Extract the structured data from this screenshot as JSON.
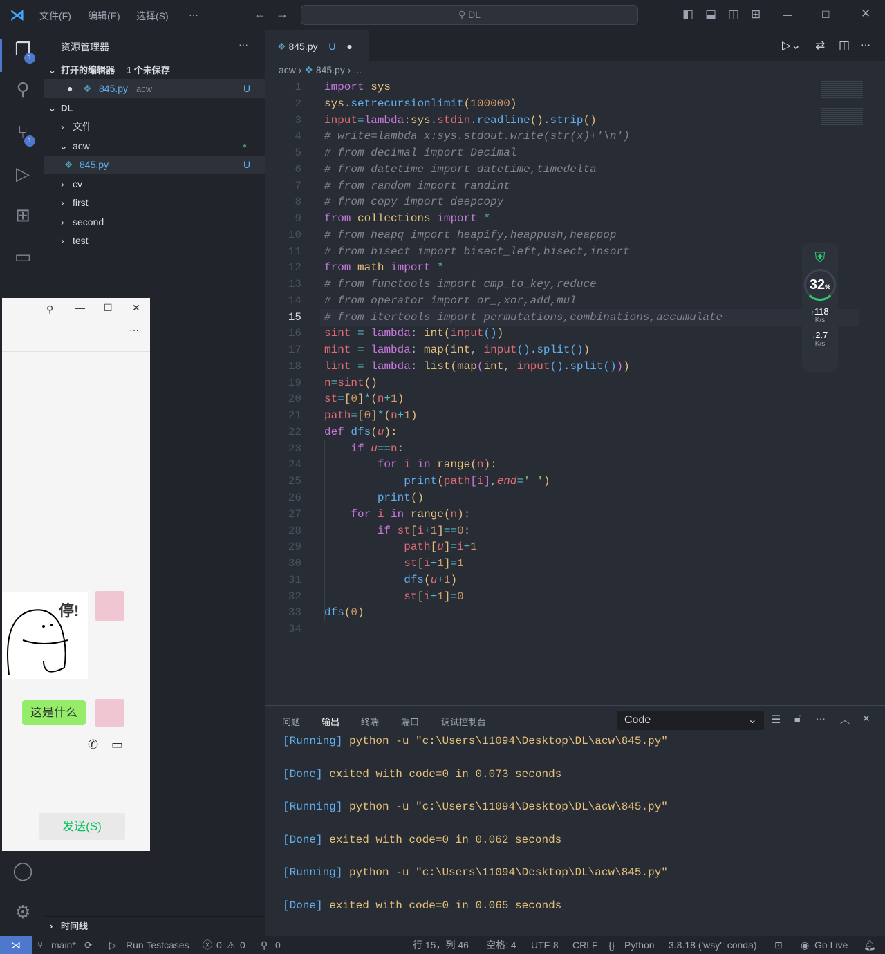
{
  "titlebar": {
    "menus": [
      "文件(F)",
      "编辑(E)",
      "选择(S)",
      "···"
    ],
    "search": "DL"
  },
  "activity": {
    "explorer_badge": "1",
    "scm_badge": "1"
  },
  "sidebar": {
    "title": "资源管理器",
    "more": "···",
    "open_editors": "打开的编辑器",
    "unsaved": "1 个未保存",
    "open_file": "845.py",
    "open_file_dir": "acw",
    "open_file_status": "U",
    "root": "DL",
    "tree": [
      {
        "label": "文件",
        "type": "folder",
        "open": false
      },
      {
        "label": "acw",
        "type": "folder",
        "open": true
      },
      {
        "label": "845.py",
        "type": "file",
        "status": "U"
      },
      {
        "label": "cv",
        "type": "folder"
      },
      {
        "label": "first",
        "type": "folder"
      },
      {
        "label": "second",
        "type": "folder"
      },
      {
        "label": "test",
        "type": "folder"
      }
    ],
    "timeline": "时间线"
  },
  "editor": {
    "tab": "845.py",
    "tab_status": "U",
    "breadcrumb": [
      "acw",
      "845.py",
      "..."
    ],
    "current_line": 15,
    "lines": [
      [
        [
          "k",
          "import"
        ],
        [
          "p",
          " "
        ],
        [
          "v",
          "sys"
        ]
      ],
      [
        [
          "v",
          "sys"
        ],
        [
          "p",
          "."
        ],
        [
          "f",
          "setrecursionlimit"
        ],
        [
          "v",
          "("
        ],
        [
          "n",
          "100000"
        ],
        [
          "v",
          ")"
        ]
      ],
      [
        [
          "r",
          "input"
        ],
        [
          "o",
          "="
        ],
        [
          "k",
          "lambda"
        ],
        [
          "p",
          ":"
        ],
        [
          "v",
          "sys"
        ],
        [
          "p",
          "."
        ],
        [
          "r",
          "stdin"
        ],
        [
          "p",
          "."
        ],
        [
          "f",
          "readline"
        ],
        [
          "v",
          "()"
        ],
        [
          "p",
          "."
        ],
        [
          "f",
          "strip"
        ],
        [
          "v",
          "()"
        ]
      ],
      [
        [
          "c",
          "# write=lambda x:sys.stdout.write(str(x)+'\\n')"
        ]
      ],
      [
        [
          "c",
          "# from decimal import Decimal"
        ]
      ],
      [
        [
          "c",
          "# from datetime import datetime,timedelta"
        ]
      ],
      [
        [
          "c",
          "# from random import randint"
        ]
      ],
      [
        [
          "c",
          "# from copy import deepcopy"
        ]
      ],
      [
        [
          "k",
          "from"
        ],
        [
          "p",
          " "
        ],
        [
          "v",
          "collections"
        ],
        [
          "p",
          " "
        ],
        [
          "k",
          "import"
        ],
        [
          "p",
          " "
        ],
        [
          "o",
          "*"
        ]
      ],
      [
        [
          "c",
          "# from heapq import heapify,heappush,heappop"
        ]
      ],
      [
        [
          "c",
          "# from bisect import bisect_left,bisect,insort"
        ]
      ],
      [
        [
          "k",
          "from"
        ],
        [
          "p",
          " "
        ],
        [
          "v",
          "math"
        ],
        [
          "p",
          " "
        ],
        [
          "k",
          "import"
        ],
        [
          "p",
          " "
        ],
        [
          "o",
          "*"
        ]
      ],
      [
        [
          "c",
          "# from functools import cmp_to_key,reduce"
        ]
      ],
      [
        [
          "c",
          "# from operator import or_,xor,add,mul"
        ]
      ],
      [
        [
          "c",
          "# from itertools import permutations,combinations,accumulate"
        ]
      ],
      [
        [
          "r",
          "sint"
        ],
        [
          "p",
          " "
        ],
        [
          "o",
          "="
        ],
        [
          "p",
          " "
        ],
        [
          "k",
          "lambda"
        ],
        [
          "p",
          ": "
        ],
        [
          "v",
          "int"
        ],
        [
          "v",
          "("
        ],
        [
          "r",
          "input"
        ],
        [
          "f",
          "()"
        ],
        [
          "v",
          ")"
        ]
      ],
      [
        [
          "r",
          "mint"
        ],
        [
          "p",
          " "
        ],
        [
          "o",
          "="
        ],
        [
          "p",
          " "
        ],
        [
          "k",
          "lambda"
        ],
        [
          "p",
          ": "
        ],
        [
          "v",
          "map"
        ],
        [
          "v",
          "("
        ],
        [
          "v",
          "int"
        ],
        [
          "p",
          ", "
        ],
        [
          "r",
          "input"
        ],
        [
          "f",
          "()"
        ],
        [
          "p",
          "."
        ],
        [
          "f",
          "split"
        ],
        [
          "f",
          "()"
        ],
        [
          "v",
          ")"
        ]
      ],
      [
        [
          "r",
          "lint"
        ],
        [
          "p",
          " "
        ],
        [
          "o",
          "="
        ],
        [
          "p",
          " "
        ],
        [
          "k",
          "lambda"
        ],
        [
          "p",
          ": "
        ],
        [
          "v",
          "list"
        ],
        [
          "v",
          "("
        ],
        [
          "v",
          "map"
        ],
        [
          "k",
          "("
        ],
        [
          "v",
          "int"
        ],
        [
          "p",
          ", "
        ],
        [
          "r",
          "input"
        ],
        [
          "f",
          "()"
        ],
        [
          "p",
          "."
        ],
        [
          "f",
          "split"
        ],
        [
          "f",
          "()"
        ],
        [
          "k",
          ")"
        ],
        [
          "v",
          ")"
        ]
      ],
      [
        [
          "r",
          "n"
        ],
        [
          "o",
          "="
        ],
        [
          "r",
          "sint"
        ],
        [
          "v",
          "()"
        ]
      ],
      [
        [
          "r",
          "st"
        ],
        [
          "o",
          "="
        ],
        [
          "v",
          "["
        ],
        [
          "n",
          "0"
        ],
        [
          "v",
          "]"
        ],
        [
          "o",
          "*"
        ],
        [
          "v",
          "("
        ],
        [
          "r",
          "n"
        ],
        [
          "o",
          "+"
        ],
        [
          "n",
          "1"
        ],
        [
          "v",
          ")"
        ]
      ],
      [
        [
          "r",
          "path"
        ],
        [
          "o",
          "="
        ],
        [
          "v",
          "["
        ],
        [
          "n",
          "0"
        ],
        [
          "v",
          "]"
        ],
        [
          "o",
          "*"
        ],
        [
          "v",
          "("
        ],
        [
          "r",
          "n"
        ],
        [
          "o",
          "+"
        ],
        [
          "n",
          "1"
        ],
        [
          "v",
          ")"
        ]
      ],
      [
        [
          "k",
          "def"
        ],
        [
          "p",
          " "
        ],
        [
          "f",
          "dfs"
        ],
        [
          "v",
          "("
        ],
        [
          "i",
          "u"
        ],
        [
          "v",
          "):"
        ]
      ],
      [
        [
          "p",
          "    "
        ],
        [
          "k",
          "if"
        ],
        [
          "p",
          " "
        ],
        [
          "i",
          "u"
        ],
        [
          "o",
          "=="
        ],
        [
          "r",
          "n"
        ],
        [
          "p",
          ":"
        ]
      ],
      [
        [
          "p",
          "        "
        ],
        [
          "k",
          "for"
        ],
        [
          "p",
          " "
        ],
        [
          "r",
          "i"
        ],
        [
          "p",
          " "
        ],
        [
          "k",
          "in"
        ],
        [
          "p",
          " "
        ],
        [
          "v",
          "range"
        ],
        [
          "v",
          "("
        ],
        [
          "r",
          "n"
        ],
        [
          "v",
          "):"
        ]
      ],
      [
        [
          "p",
          "            "
        ],
        [
          "f",
          "print"
        ],
        [
          "v",
          "("
        ],
        [
          "r",
          "path"
        ],
        [
          "k",
          "["
        ],
        [
          "r",
          "i"
        ],
        [
          "k",
          "]"
        ],
        [
          "p",
          ","
        ],
        [
          "i",
          "end"
        ],
        [
          "o",
          "="
        ],
        [
          "g",
          "' '"
        ],
        [
          "v",
          ")"
        ]
      ],
      [
        [
          "p",
          "        "
        ],
        [
          "f",
          "print"
        ],
        [
          "v",
          "()"
        ]
      ],
      [
        [
          "p",
          "    "
        ],
        [
          "k",
          "for"
        ],
        [
          "p",
          " "
        ],
        [
          "r",
          "i"
        ],
        [
          "p",
          " "
        ],
        [
          "k",
          "in"
        ],
        [
          "p",
          " "
        ],
        [
          "v",
          "range"
        ],
        [
          "v",
          "("
        ],
        [
          "r",
          "n"
        ],
        [
          "v",
          "):"
        ]
      ],
      [
        [
          "p",
          "        "
        ],
        [
          "k",
          "if"
        ],
        [
          "p",
          " "
        ],
        [
          "r",
          "st"
        ],
        [
          "v",
          "["
        ],
        [
          "r",
          "i"
        ],
        [
          "o",
          "+"
        ],
        [
          "n",
          "1"
        ],
        [
          "v",
          "]"
        ],
        [
          "o",
          "=="
        ],
        [
          "n",
          "0"
        ],
        [
          "p",
          ":"
        ]
      ],
      [
        [
          "p",
          "            "
        ],
        [
          "r",
          "path"
        ],
        [
          "v",
          "["
        ],
        [
          "i",
          "u"
        ],
        [
          "v",
          "]"
        ],
        [
          "o",
          "="
        ],
        [
          "r",
          "i"
        ],
        [
          "o",
          "+"
        ],
        [
          "n",
          "1"
        ]
      ],
      [
        [
          "p",
          "            "
        ],
        [
          "r",
          "st"
        ],
        [
          "v",
          "["
        ],
        [
          "r",
          "i"
        ],
        [
          "o",
          "+"
        ],
        [
          "n",
          "1"
        ],
        [
          "v",
          "]"
        ],
        [
          "o",
          "="
        ],
        [
          "n",
          "1"
        ]
      ],
      [
        [
          "p",
          "            "
        ],
        [
          "f",
          "dfs"
        ],
        [
          "v",
          "("
        ],
        [
          "i",
          "u"
        ],
        [
          "o",
          "+"
        ],
        [
          "n",
          "1"
        ],
        [
          "v",
          ")"
        ]
      ],
      [
        [
          "p",
          "            "
        ],
        [
          "r",
          "st"
        ],
        [
          "v",
          "["
        ],
        [
          "r",
          "i"
        ],
        [
          "o",
          "+"
        ],
        [
          "n",
          "1"
        ],
        [
          "v",
          "]"
        ],
        [
          "o",
          "="
        ],
        [
          "n",
          "0"
        ]
      ],
      [
        [
          "f",
          "dfs"
        ],
        [
          "v",
          "("
        ],
        [
          "n",
          "0"
        ],
        [
          "v",
          ")"
        ]
      ],
      []
    ]
  },
  "net_monitor": {
    "cpu": "32",
    "cpu_unit": "%",
    "up": "118",
    "up_unit": "K/s",
    "down": "2.7",
    "down_unit": "K/s"
  },
  "panel": {
    "tabs": [
      "问题",
      "输出",
      "终端",
      "端口",
      "调试控制台"
    ],
    "active_tab": "输出",
    "channel": "Code",
    "output": [
      {
        "tag": "[Running]",
        "text": " python -u \"c:\\Users\\11094\\Desktop\\DL\\acw\\845.py\""
      },
      {
        "tag": "[Done]",
        "text": " exited with code=0 in 0.073 seconds"
      },
      {
        "tag": "[Running]",
        "text": " python -u \"c:\\Users\\11094\\Desktop\\DL\\acw\\845.py\""
      },
      {
        "tag": "[Done]",
        "text": " exited with code=0 in 0.062 seconds"
      },
      {
        "tag": "[Running]",
        "text": " python -u \"c:\\Users\\11094\\Desktop\\DL\\acw\\845.py\""
      },
      {
        "tag": "[Done]",
        "text": " exited with code=0 in 0.065 seconds"
      }
    ]
  },
  "chat": {
    "sticker_text": "停!",
    "message": "这是什么",
    "send": "发送(S)"
  },
  "statusbar": {
    "branch": "main*",
    "run": "Run Testcases",
    "errors": "0",
    "warnings": "0",
    "ports": "0",
    "position": "行 15，列 46",
    "spaces": "空格: 4",
    "encoding": "UTF-8",
    "eol": "CRLF",
    "language": "Python",
    "interpreter": "3.8.18 ('wsy': conda)",
    "golive": "Go Live"
  }
}
